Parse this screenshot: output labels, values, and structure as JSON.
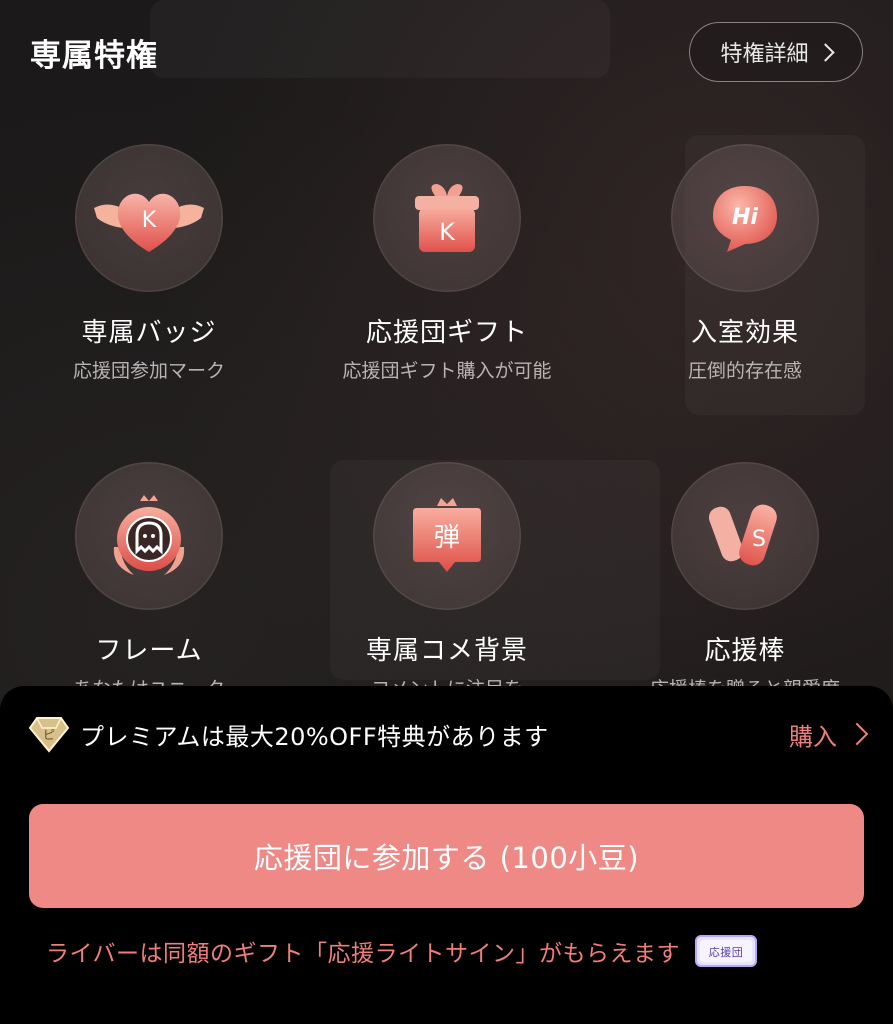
{
  "header": {
    "title": "専属特権",
    "detail_button": "特権詳細"
  },
  "features": [
    {
      "icon": "badge-k-icon",
      "title": "専属バッジ",
      "subtitle": "応援団参加マーク"
    },
    {
      "icon": "gift-k-icon",
      "title": "応援団ギフト",
      "subtitle": "応援団ギフト購入が可能"
    },
    {
      "icon": "hi-bubble-icon",
      "title": "入室効果",
      "subtitle": "圧倒的存在感"
    },
    {
      "icon": "frame-ghost-icon",
      "title": "フレーム",
      "subtitle": "あなたはユニーク"
    },
    {
      "icon": "danmaku-bubble-icon",
      "title": "専属コメ背景",
      "subtitle": "コメントに注目を"
    },
    {
      "icon": "cheer-stick-icon",
      "title": "応援棒",
      "subtitle": "応援棒を贈ると親愛度"
    }
  ],
  "icon_glyphs": {
    "badge": "K",
    "gift": "K",
    "bubble": "Hi",
    "danmaku": "弾",
    "stick": "S",
    "diamond": "ピ"
  },
  "promo": {
    "text": "プレミアムは最大20%OFF特典があります",
    "buy_label": "購入"
  },
  "join_button": "応援団に参加する (100小豆)",
  "note": "ライバーは同額のギフト「応援ライトサイン」がもらえます",
  "sticker_label": "応援団",
  "colors": {
    "accent": "#ee8985",
    "accent_text": "#f07e7a",
    "icon_gradient_top": "#f6a39b",
    "icon_gradient_bottom": "#e2564f"
  }
}
